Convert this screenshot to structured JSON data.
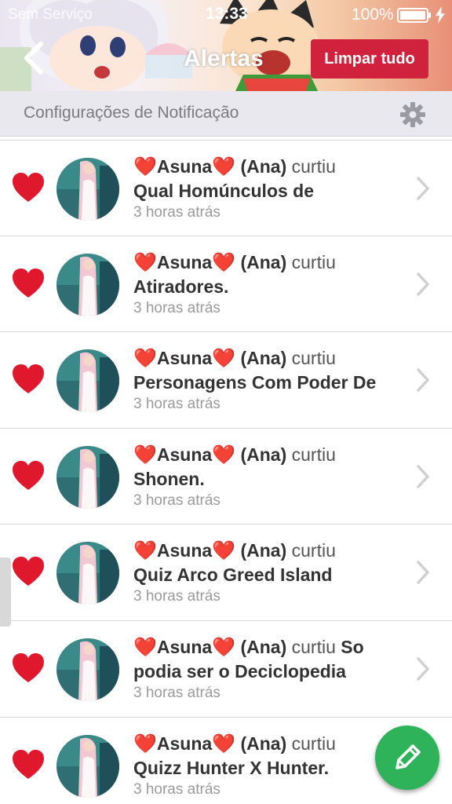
{
  "status_bar": {
    "carrier": "Sem Serviço",
    "time": "13:33",
    "battery": "100%"
  },
  "header": {
    "title": "Alertas",
    "clear_button": "Limpar tudo"
  },
  "settings": {
    "label": "Configurações de Notificação"
  },
  "colors": {
    "accent_red": "#d0213d",
    "like_red": "#e0182d",
    "compose_green": "#2fb35a"
  },
  "notifications": [
    {
      "heart1": "❤️",
      "user": "Asuna",
      "heart2": "❤️",
      "name": "(Ana)",
      "action": "curtiu",
      "inline": "",
      "post": "Qual Homúnculos de",
      "time": "3 horas atrás"
    },
    {
      "heart1": "❤️",
      "user": "Asuna",
      "heart2": "❤️",
      "name": "(Ana)",
      "action": "curtiu",
      "inline": "",
      "post": "Atiradores.",
      "time": "3 horas atrás"
    },
    {
      "heart1": "❤️",
      "user": "Asuna",
      "heart2": "❤️",
      "name": "(Ana)",
      "action": "curtiu",
      "inline": "",
      "post": "Personagens Com Poder De",
      "time": "3 horas atrás"
    },
    {
      "heart1": "❤️",
      "user": "Asuna",
      "heart2": "❤️",
      "name": "(Ana)",
      "action": "curtiu",
      "inline": "",
      "post": "Shonen.",
      "time": "3 horas atrás"
    },
    {
      "heart1": "❤️",
      "user": "Asuna",
      "heart2": "❤️",
      "name": "(Ana)",
      "action": "curtiu",
      "inline": "",
      "post": "Quiz Arco Greed Island",
      "time": "3 horas atrás"
    },
    {
      "heart1": "❤️",
      "user": "Asuna",
      "heart2": "❤️",
      "name": "(Ana)",
      "action": "curtiu",
      "inline": "So",
      "post": "podia ser o Deciclopedia",
      "time": "3 horas atrás"
    },
    {
      "heart1": "❤️",
      "user": "Asuna",
      "heart2": "❤️",
      "name": "(Ana)",
      "action": "curtiu",
      "inline": "",
      "post": "Quizz Hunter X Hunter.",
      "time": "3 horas atrás"
    }
  ]
}
